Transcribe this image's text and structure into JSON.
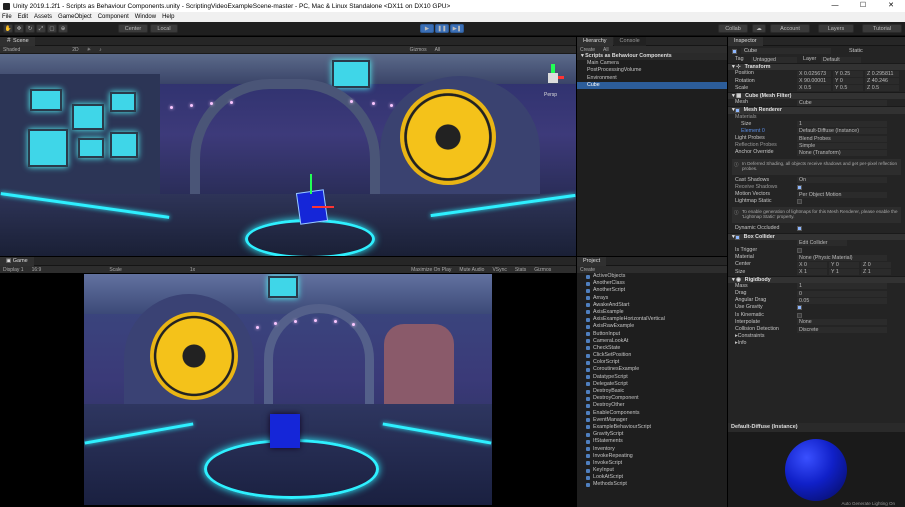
{
  "titlebar": {
    "title": "Unity 2019.1.2f1 - Scripts as Behaviour Components.unity - ScriptingVideoExampleScene-master - PC, Mac & Linux Standalone <DX11 on DX10 GPU>",
    "controls": [
      "—",
      "☐",
      "✕"
    ]
  },
  "menu": [
    "File",
    "Edit",
    "Assets",
    "GameObject",
    "Component",
    "Window",
    "Help"
  ],
  "toolbar": {
    "pivot": "Center",
    "space": "Local",
    "collab": "Collab",
    "account": "Account",
    "layers": "Layers",
    "layout": "Tutorial"
  },
  "scene": {
    "tab": "Scene",
    "shading": "Shaded",
    "mode": "2D",
    "gizmos": "Gizmos",
    "search": "All",
    "persp": "Persp"
  },
  "game": {
    "tab": "Game",
    "display": "Display 1",
    "aspect": "16:9",
    "scale_label": "Scale",
    "scale_value": "1x",
    "maximize": "Maximize On Play",
    "mute": "Mute Audio",
    "vsync": "VSync",
    "stats": "Stats",
    "gizmos": "Gizmos"
  },
  "hierarchy": {
    "tab": "Hierarchy",
    "tab2": "Console",
    "create": "Create",
    "search": "All",
    "scene_name": "Scripts as Behaviour Components",
    "items": [
      "Main Camera",
      "PostProcessingVolume",
      "Environment",
      "Cube"
    ]
  },
  "project": {
    "tab": "Project",
    "create": "Create",
    "items": [
      "ActiveObjects",
      "AnotherClass",
      "AnotherScript",
      "Arrays",
      "AwakeAndStart",
      "AxisExample",
      "AxisExampleHorizontalVertical",
      "AxisRawExample",
      "ButtonInput",
      "CameraLookAt",
      "CheckState",
      "ClickSetPosition",
      "ColorScript",
      "CoroutinesExample",
      "DatatypeScript",
      "DelegateScript",
      "DestroyBasic",
      "DestroyComponent",
      "DestroyOther",
      "EnableComponents",
      "EventManager",
      "ExampleBehaviourScript",
      "GravityScript",
      "IfStatements",
      "Inventory",
      "InvokeRepeating",
      "InvokeScript",
      "KeyInput",
      "LookAtScript",
      "MethodsScript"
    ]
  },
  "inspector": {
    "tab": "Inspector",
    "object_name": "Cube",
    "static": "Static",
    "tag_label": "Tag",
    "tag": "Untagged",
    "layer_label": "Layer",
    "layer": "Default",
    "transform": {
      "title": "Transform",
      "position_label": "Position",
      "position": [
        "X 0.025673",
        "Y 0.25",
        "Z 0.295811"
      ],
      "rotation_label": "Rotation",
      "rotation": [
        "X 90.00001",
        "Y 0",
        "Z 40.246"
      ],
      "scale_label": "Scale",
      "scale": [
        "X 0.5",
        "Y 0.5",
        "Z 0.5"
      ]
    },
    "mesh_filter": {
      "title": "Cube (Mesh Filter)",
      "mesh_label": "Mesh",
      "mesh": "Cube"
    },
    "mesh_renderer": {
      "title": "Mesh Renderer",
      "materials_label": "Materials",
      "size_label": "Size",
      "size": "1",
      "element_label": "Element 0",
      "element": "Default-Diffuse (Instance)",
      "light_probes_label": "Light Probes",
      "light_probes": "Blend Probes",
      "reflection_label": "Reflection Probes",
      "reflection": "Simple",
      "anchor_label": "Anchor Override",
      "anchor": "None (Transform)",
      "info1": "In Deferred Shading, all objects receive shadows and get per-pixel reflection probes.",
      "cast_label": "Cast Shadows",
      "cast": "On",
      "receive_label": "Receive Shadows",
      "motion_label": "Motion Vectors",
      "motion": "Per Object Motion",
      "lightmap_label": "Lightmap Static",
      "info2": "To enable generation of lightmaps for this Mesh Renderer, please enable the 'Lightmap Static' property.",
      "occluded_label": "Dynamic Occluded"
    },
    "box_collider": {
      "title": "Box Collider",
      "edit": "Edit Collider",
      "trigger_label": "Is Trigger",
      "material_label": "Material",
      "material": "None (Physic Material)",
      "center_label": "Center",
      "center": [
        "X 0",
        "Y 0",
        "Z 0"
      ],
      "size_label": "Size",
      "size": [
        "X 1",
        "Y 1",
        "Z 1"
      ]
    },
    "rigidbody": {
      "title": "Rigidbody",
      "mass_label": "Mass",
      "mass": "1",
      "drag_label": "Drag",
      "drag": "0",
      "angular_label": "Angular Drag",
      "angular": "0.05",
      "gravity_label": "Use Gravity",
      "kinematic_label": "Is Kinematic",
      "interpolate_label": "Interpolate",
      "interpolate": "None",
      "collision_label": "Collision Detection",
      "collision": "Discrete",
      "constraints_label": "Constraints",
      "info_label": "Info"
    },
    "preview": {
      "title": "Default-Diffuse (Instance)",
      "footer": "Auto Generate Lighting On",
      "sphere_color": "#1020c8"
    }
  },
  "colors": {
    "accent": "#3b6fb6",
    "cyan": "#2ef0ff",
    "fan": "#f4c21a",
    "cube": "#1526d8"
  }
}
